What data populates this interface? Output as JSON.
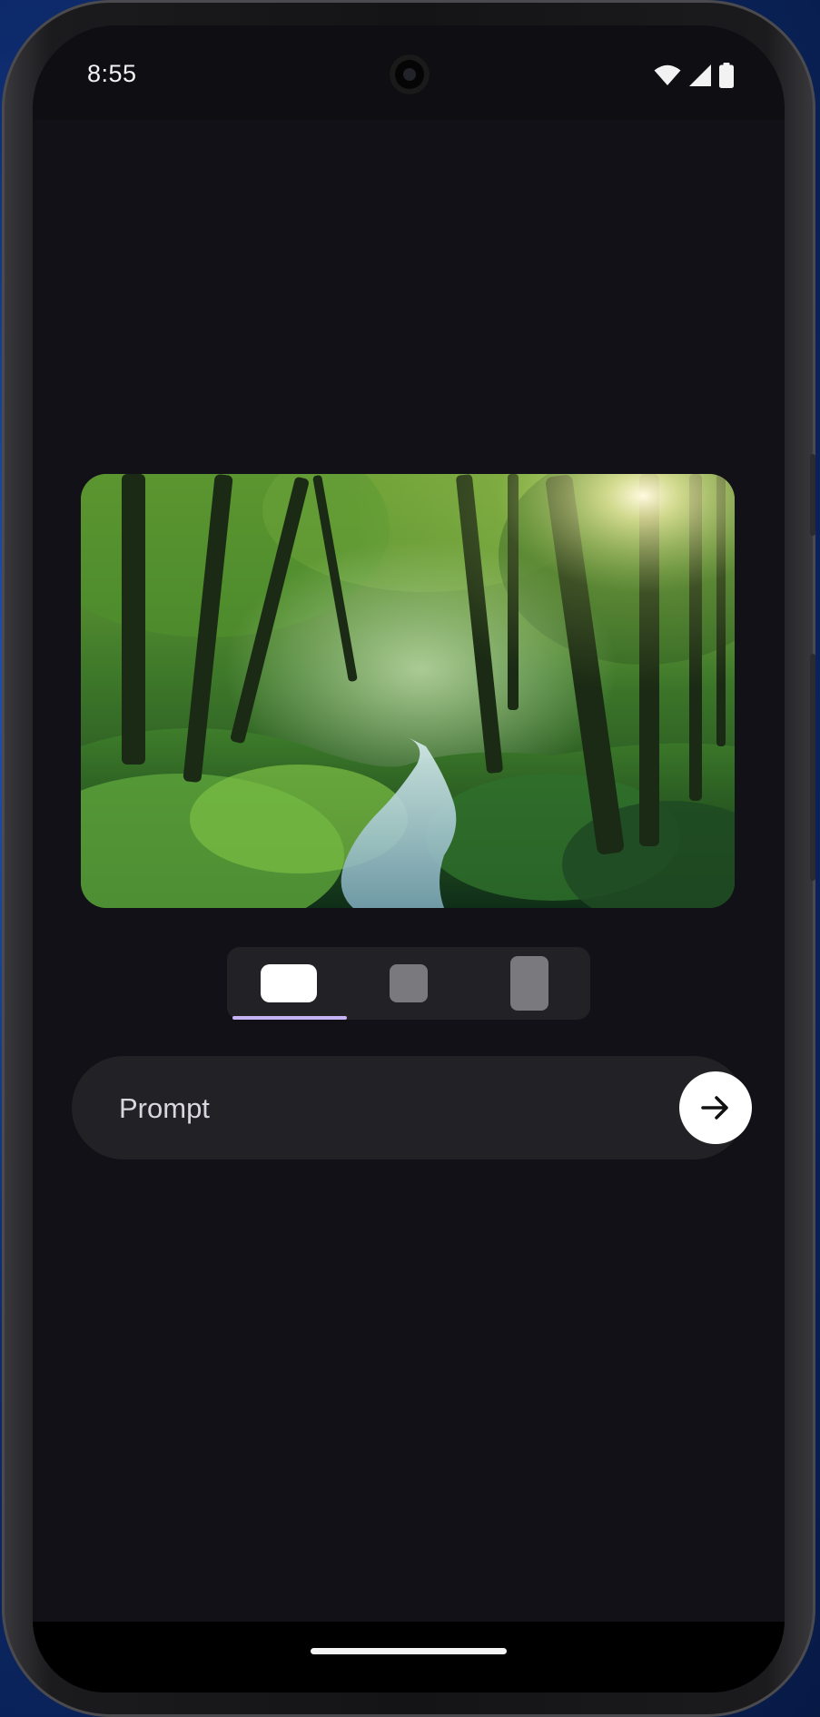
{
  "status_bar": {
    "time": "8:55",
    "icons": [
      "wifi-icon",
      "cellular-signal-icon",
      "battery-icon"
    ]
  },
  "hero_image": {
    "description_icon": "forest-stream-image"
  },
  "aspect_selector": {
    "options": [
      "landscape-aspect-icon",
      "square-aspect-icon",
      "portrait-aspect-icon"
    ],
    "selected_index": 0
  },
  "prompt": {
    "placeholder": "Prompt",
    "value": "",
    "send_icon": "arrow-right-icon"
  },
  "colors": {
    "background": "#131118",
    "surface": "#222125",
    "accent": "#c6b3f5",
    "on_surface": "#d9d6df"
  }
}
